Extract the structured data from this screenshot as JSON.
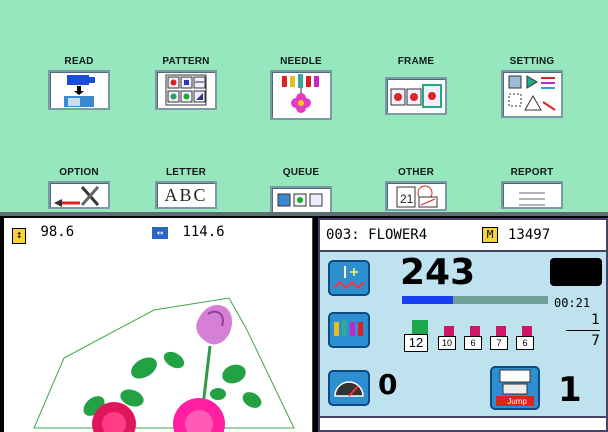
{
  "menu": {
    "read": "READ",
    "pattern": "PATTERN",
    "needle": "NEEDLE",
    "frame": "FRAME",
    "setting": "SETTING",
    "option": "OPTION",
    "letter": "LETTER",
    "letter_preview": "ABC",
    "queue": "QUEUE",
    "other": "OTHER",
    "report": "REPORT"
  },
  "canvas": {
    "height_value": "98.6",
    "width_value": "114.6"
  },
  "status": {
    "design_name": "003: FLOWER4",
    "stitch_count": "13497",
    "current_stitch": "243",
    "elapsed_time": "00:21",
    "progress_fraction": 0.35,
    "current_needle": "12",
    "needle_seq": [
      "10",
      "6",
      "7",
      "6"
    ],
    "fraction_num": "1",
    "fraction_den": "7",
    "speed_value": "0",
    "jump_value": "1",
    "jump_label": "Jump"
  }
}
